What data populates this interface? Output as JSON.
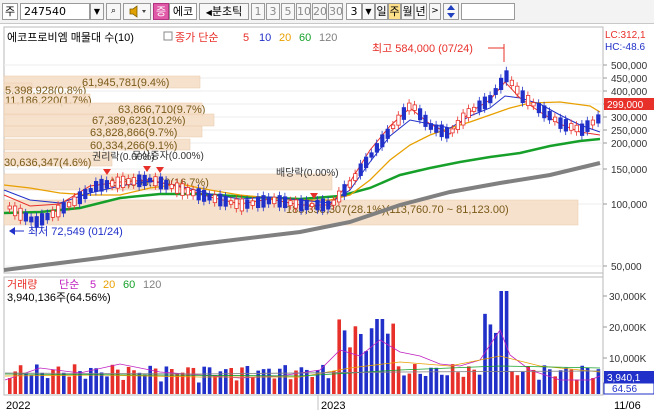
{
  "toolbar": {
    "market": "주",
    "code": "247540",
    "indicator_btn": "증",
    "indicator_name": "에코",
    "interval_label": "분초틱",
    "minute_options": [
      "1",
      "3",
      "5",
      "10",
      "20",
      "30"
    ],
    "count": "3",
    "day": "일",
    "week": "주",
    "month": "월",
    "year": "년",
    "speaker_icon": "speaker-icon",
    "updown_icon": "up-down-arrow-icon"
  },
  "price_panel": {
    "title": "에코프로비엠 매물대 수(10)",
    "ma_prefix": "종가 단순",
    "ma_periods": [
      "5",
      "10",
      "20",
      "60",
      "120"
    ],
    "ma_colors": [
      "#e8302a",
      "#2030c8",
      "#e8a000",
      "#16a02a",
      "#808080"
    ],
    "lc": "LC:312,1",
    "hc": "HC:-48.6",
    "current_price": "299,000",
    "high_label": "최고 584,000 (07/24)",
    "low_label": "최저 72,549 (01/24)",
    "dividend_labels": [
      "권리락(0.00%)",
      "무상증자(0.00%)",
      "배당락(0.00%)"
    ],
    "volume_profile": [
      "61,945,781(9.4%)",
      "5,398,928(0.8%)",
      "11,186,220(1.7%)",
      "63,866,710(9.7%)",
      "67,389,623(10.2%)",
      "63,828,866(9.7%)",
      "60,334,266(9.1%)",
      "30,636,347(4.6%)",
      "110,599,170(16.7%)",
      "185,358,307(28.1%)(113,760.70 ~ 81,123.00)"
    ],
    "y_ticks": [
      "500,000",
      "450,000",
      "400,000",
      "350,000",
      "300,000",
      "250,000",
      "200,000",
      "150,000",
      "100,000",
      "50,000"
    ]
  },
  "volume_panel": {
    "title": "거래량",
    "ma_prefix": "단순",
    "ma_periods": [
      "5",
      "20",
      "60",
      "120"
    ],
    "ma_colors": [
      "#c020c0",
      "#e8a000",
      "#16a02a",
      "#808080"
    ],
    "value": "3,940,136주(64.56%)",
    "current_volume": "3,940,1",
    "ratio": "64.56",
    "y_ticks": [
      "30,000K",
      "20,000K",
      "10,000K"
    ]
  },
  "x_axis": {
    "labels": [
      "2022",
      "2023",
      "11/06"
    ]
  }
}
